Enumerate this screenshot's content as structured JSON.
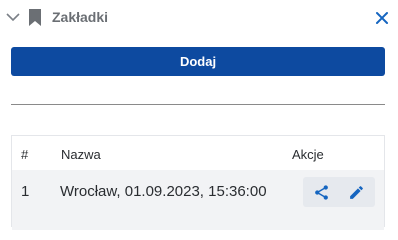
{
  "panel": {
    "title": "Zakładki",
    "add_label": "Dodaj",
    "icons": {
      "collapse": "chevron-down-icon",
      "bookmark": "bookmark-icon",
      "close": "close-icon"
    },
    "colors": {
      "accent": "#0d4aa0",
      "icon_blue": "#1565c0"
    }
  },
  "table": {
    "headers": [
      "#",
      "Nazwa",
      "Akcje"
    ],
    "rows": [
      {
        "index": "1",
        "name": "Wrocław, 01.09.2023, 15:36:00",
        "actions": [
          "share-icon",
          "edit-icon"
        ]
      }
    ]
  }
}
